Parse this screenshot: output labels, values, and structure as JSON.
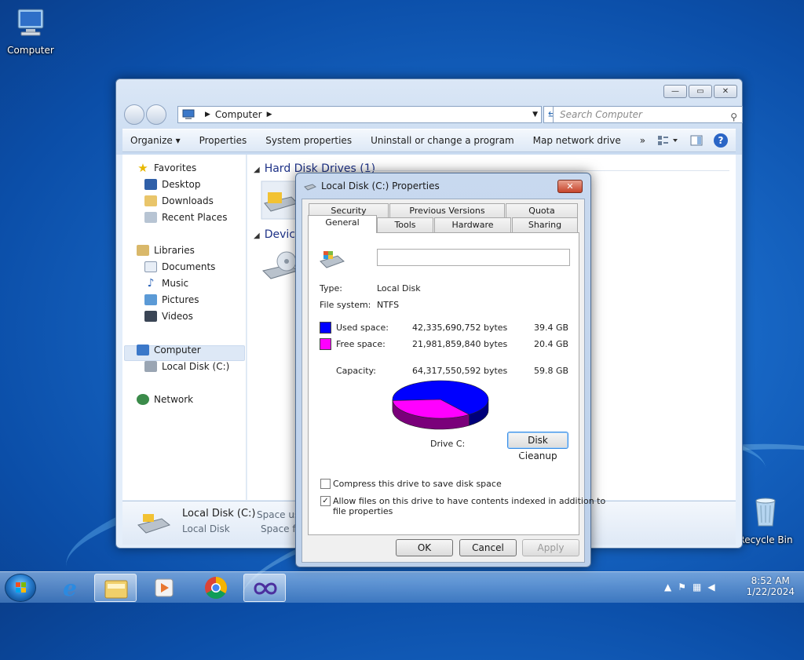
{
  "desktop": {
    "icons": [
      {
        "label": "Computer"
      },
      {
        "label": "Recycle Bin"
      }
    ]
  },
  "explorer": {
    "window_buttons": [
      "—",
      "▭",
      "✕"
    ],
    "address": {
      "root_label": "Computer"
    },
    "search": {
      "placeholder": "Search Computer"
    },
    "toolbar": {
      "organize": "Organize ▾",
      "properties": "Properties",
      "system_properties": "System properties",
      "uninstall": "Uninstall or change a program",
      "map_drive": "Map network drive",
      "more": "»",
      "help": "?"
    },
    "nav": {
      "favorites": "Favorites",
      "desktop": "Desktop",
      "downloads": "Downloads",
      "recent": "Recent Places",
      "libraries": "Libraries",
      "documents": "Documents",
      "music": "Music",
      "pictures": "Pictures",
      "videos": "Videos",
      "computer": "Computer",
      "local_disk": "Local Disk (C:)",
      "network": "Network"
    },
    "groups": {
      "hdd": "Hard Disk Drives (1)",
      "devices": "Device"
    },
    "details": {
      "name": "Local Disk (C:)",
      "type": "Local Disk",
      "space_used": "Space used",
      "space_free": "Space free"
    }
  },
  "dialog": {
    "title": "Local Disk (C:) Properties",
    "close": "✕",
    "tabs": {
      "security": "Security",
      "previous_versions": "Previous Versions",
      "quota": "Quota",
      "general": "General",
      "tools": "Tools",
      "hardware": "Hardware",
      "sharing": "Sharing"
    },
    "type_label": "Type:",
    "type_value": "Local Disk",
    "fs_label": "File system:",
    "fs_value": "NTFS",
    "used_label": "Used space:",
    "used_bytes": "42,335,690,752 bytes",
    "used_gb": "39.4 GB",
    "free_label": "Free space:",
    "free_bytes": "21,981,859,840 bytes",
    "free_gb": "20.4 GB",
    "capacity_label": "Capacity:",
    "capacity_bytes": "64,317,550,592 bytes",
    "capacity_gb": "59.8 GB",
    "drive_label": "Drive C:",
    "disk_cleanup": "Disk Cleanup",
    "compress_label": "Compress this drive to save disk space",
    "compress_checked": false,
    "index_label_1": "Allow files on this drive to have contents indexed in addition to",
    "index_label_2": "file properties",
    "index_checked": true,
    "ok": "OK",
    "cancel": "Cancel",
    "apply": "Apply",
    "colors": {
      "used": "#0000ff",
      "free": "#ff00ff"
    },
    "used_fraction": 0.658
  },
  "taskbar": {
    "time": "8:52 AM",
    "date": "1/22/2024"
  }
}
